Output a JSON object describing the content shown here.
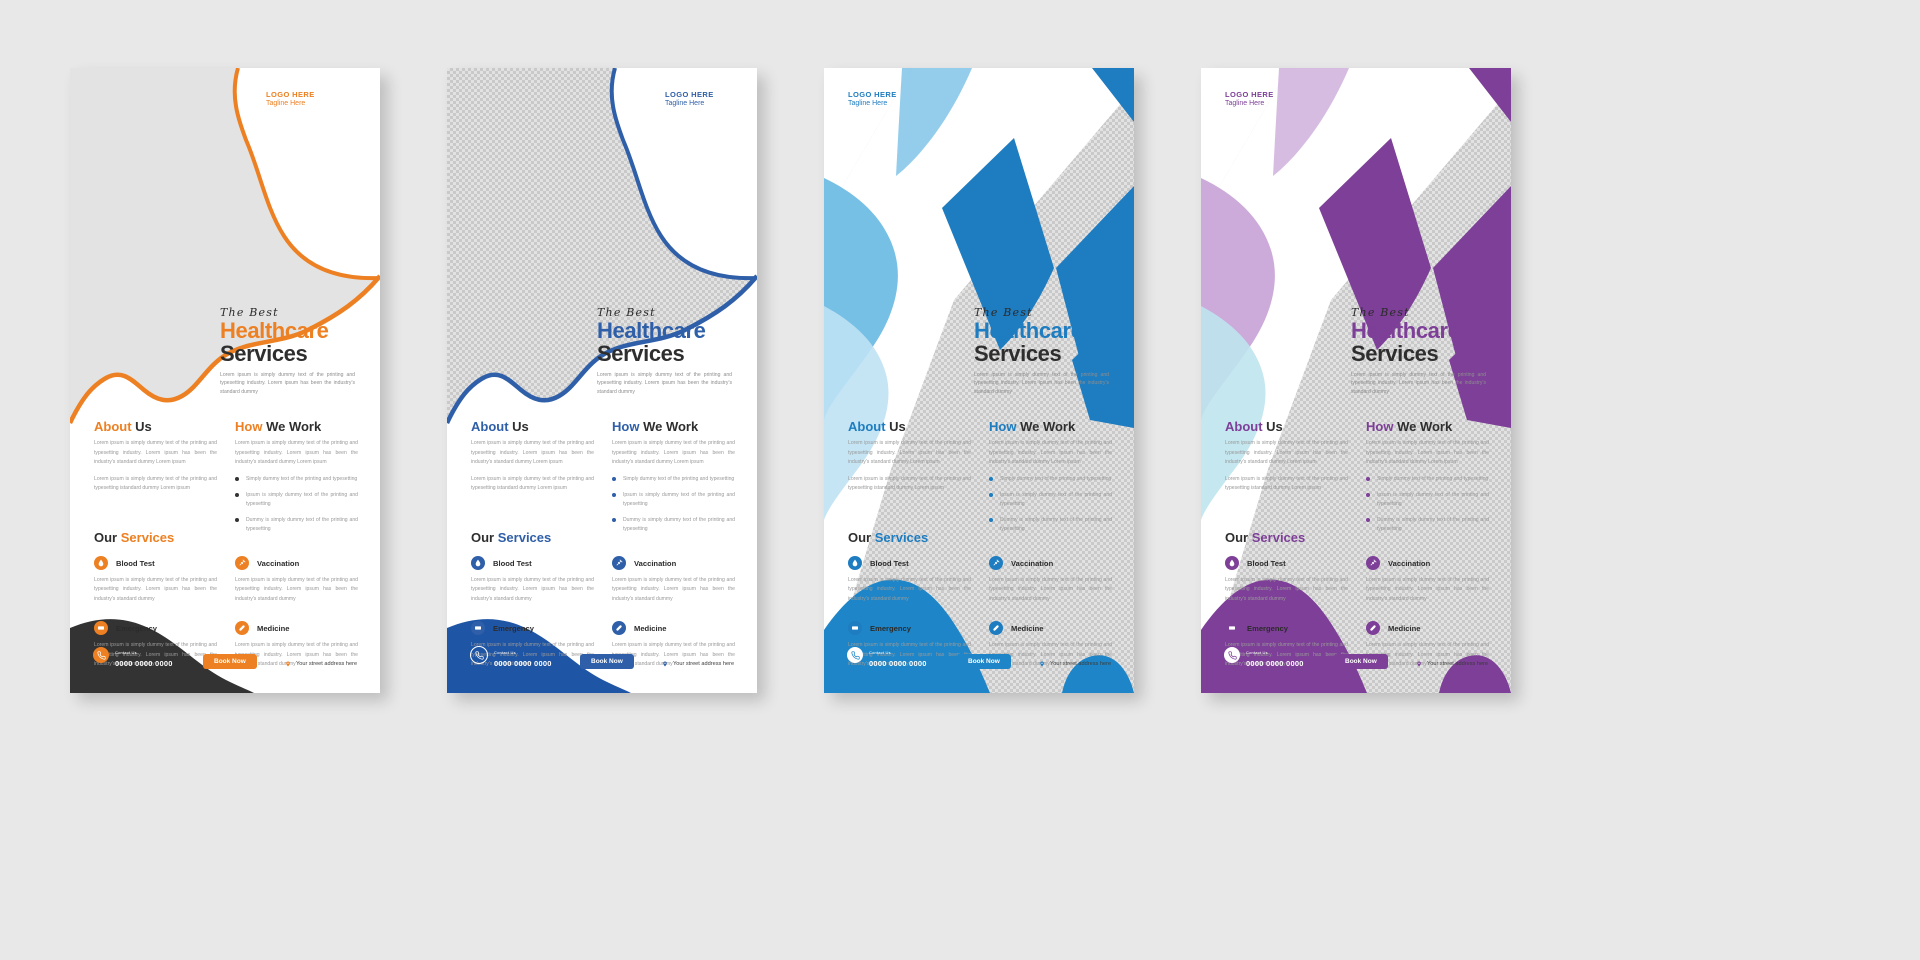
{
  "page": {
    "background": "#e8e8e8",
    "flyer_count": 4
  },
  "shared": {
    "logo": {
      "title": "LOGO HERE",
      "tagline": "Tagline Here"
    },
    "hero": {
      "script": "The Best",
      "accent_word": "Healthcare",
      "plain_word": "Services",
      "description": "Lorem ipsum is simply dummy text of the printing and typesetting industry. Lorem ipsum has been the industry's standard dummy"
    },
    "about": {
      "heading_accent": "About",
      "heading_plain": "Us",
      "paragraphs": [
        "Lorem ipsum is simply dummy text of the printing and typesetting industry. Lorem ipsum has been the industry's standard dummy Lorem ipsum",
        "Lorem ipsum is simply dummy text of the printing and typesetting istandard dummy Lorem ipsum"
      ]
    },
    "how": {
      "heading_accent": "How",
      "heading_plain": "We Work",
      "paragraph": "Lorem ipsum is simply dummy text of the printing and typesetting industry. Lorem ipsum has been the industry's standard dummy Lorem ipsum",
      "bullets": [
        "Simply dummy text of the printing and typesetting",
        "Ipsum is simply dummy text of the printing and typesetting",
        "Dummy is simply dummy text of the printing and typesetting"
      ]
    },
    "services": {
      "heading_plain": "Our",
      "heading_accent": "Services",
      "items": [
        {
          "icon": "blood-drop-icon",
          "name": "Blood Test",
          "text": "Lorem ipsum is simply dummy text of the printing and typesetting industry. Lorem ipsum has been the industry's standard dummy"
        },
        {
          "icon": "syringe-icon",
          "name": "Vaccination",
          "text": "Lorem ipsum is simply dummy text of the printing and typesetting industry. Lorem ipsum has been the industry's standard dummy"
        },
        {
          "icon": "ambulance-icon",
          "name": "Emergency",
          "text": "Lorem ipsum is simply dummy text of the printing and typesetting industry. Lorem ipsum has been the industry's standard dummy"
        },
        {
          "icon": "pill-icon",
          "name": "Medicine",
          "text": "Lorem ipsum is simply dummy text of the printing and typesetting industry. Lorem ipsum has been the industry's standard dummy"
        }
      ]
    },
    "footer": {
      "contact_label": "Contact Us",
      "contact_phone": "0000 0000 0000",
      "book_button": "Book Now",
      "address": "Your street address here",
      "contact_icon": "phone-icon",
      "address_icon": "location-pin-icon"
    }
  },
  "flyers": [
    {
      "id": "flyer-orange",
      "style": "wave",
      "accent": "#ED8022",
      "accent_dark": "#E0761A",
      "accent_light": "#F6B177",
      "footer_shape": "#333333",
      "bullet_color": "#333333",
      "logo_color": "#ED8022",
      "logo_tag_color": "#ED8022",
      "background": "#E3E3E3",
      "background_kind": "flat",
      "contact_ico_bg": "#ED8022",
      "contact_ico_fg": "#ffffff",
      "contact_text_color": "#ffffff",
      "addr_ico_bg": "#ED8022",
      "book_bg": "#ED8022"
    },
    {
      "id": "flyer-blue-wave",
      "style": "wave",
      "accent": "#2F5FA8",
      "accent_dark": "#24539B",
      "accent_light": "#7FA0CF",
      "footer_shape": "#1F55A5",
      "bullet_color": "#2F5FA8",
      "logo_color": "#2F5FA8",
      "logo_tag_color": "#2F5FA8",
      "background": "#E2E2E2",
      "background_kind": "checker",
      "contact_ico_bg": "transparent",
      "contact_ico_fg": "#ffffff",
      "contact_text_color": "#ffffff",
      "addr_ico_bg": "#2F5FA8",
      "book_bg": "#2F5FA8"
    },
    {
      "id": "flyer-blue-diagonal",
      "style": "diagonal",
      "accent": "#1E7CC0",
      "accent_dark": "#1878BD",
      "accent_light": "#6FBCE4",
      "accent_pale": "#BFE2F4",
      "footer_shape": "#1E86C8",
      "bullet_color": "#1E7CC0",
      "logo_color": "#1E7CC0",
      "logo_tag_color": "#1E7CC0",
      "background": "#E2E2E2",
      "background_kind": "checker",
      "contact_ico_bg": "#ffffff",
      "contact_ico_fg": "#1E86C8",
      "contact_text_color": "#ffffff",
      "addr_ico_bg": "#1E7CC0",
      "book_bg": "#1E86C8"
    },
    {
      "id": "flyer-purple-diagonal",
      "style": "diagonal",
      "accent": "#7D3F97",
      "accent_dark": "#6E3489",
      "accent_light": "#C9A5D8",
      "accent_pale": "#BFE4EE",
      "footer_shape": "#7D3F97",
      "bullet_color": "#7D3F97",
      "logo_color": "#7D3F97",
      "logo_tag_color": "#7D3F97",
      "background": "#E2E2E2",
      "background_kind": "checker",
      "contact_ico_bg": "#ffffff",
      "contact_ico_fg": "#7D3F97",
      "contact_text_color": "#ffffff",
      "addr_ico_bg": "#7D3F97",
      "book_bg": "#7D3F97"
    }
  ]
}
